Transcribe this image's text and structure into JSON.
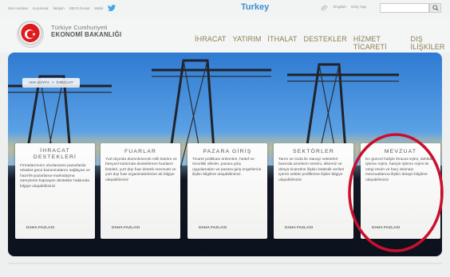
{
  "topbar": {
    "links": [
      "Site Haritası",
      "Kurumsal",
      "İletişim",
      "EBYS Evrak",
      "Mobil"
    ],
    "center_label": "Turkey",
    "lang_links": [
      "English",
      "Giriş Yap"
    ],
    "search_placeholder": ""
  },
  "header": {
    "org_line1": "Türkiye Cumhuriyeti",
    "org_line2": "EKONOMİ BAKANLIĞI",
    "nav": [
      "İHRACAT",
      "YATIRIM",
      "İTHALAT",
      "DESTEKLER",
      "HİZMET TİCARETİ",
      "DIŞ İLİŞKİLER"
    ]
  },
  "breadcrumb": {
    "home": "ANA SAYFA",
    "separator": ">",
    "current": "İHRACAT"
  },
  "cards": [
    {
      "title_lines": [
        "İHRACAT",
        "DESTEKLERİ"
      ],
      "body": "Firmalarımızın uluslararası pazarlarda rekabet gücü kazanmalarını sağlayan ve hazırlık-pazarlama-markalaşma süreçlerini kapsayan destekler hakkında bilgiye ulaşabilirsiniz",
      "more": "DAHA FAZLASI"
    },
    {
      "title_lines": [
        "FUARLAR"
      ],
      "body": "Yurt dışında düzenlenecek milli katılım ve bireysel katılımda desteklenen fuarların listeleri, yurt dışı fuar destek mevzuatı ve yurt dışı fuar organizatörlerine ait bilgiye ulaşabilirsiniz",
      "more": "DAHA FAZLASI"
    },
    {
      "title_lines": [
        "PAZARA GİRİŞ"
      ],
      "body": "Ticaret politikası önlemleri, hedef ve öncelikli ülkeler, pazara giriş uygulamaları ve pazara giriş engellerine ilişkin bilgilere ulaşabilirsiniz.",
      "more": "DAHA FAZLASI"
    },
    {
      "title_lines": [
        "SEKTÖRLER"
      ],
      "body": "Tarım ve Gıda ile Sanayi sektörleri bazında ürünlerin üretimi, ülkemiz ve dünya ticaretine ilişkin istatistik verileri içeren sektör profillerine ilişkin bilgiye ulaşabilirsiniz",
      "more": "DAHA FAZLASI"
    },
    {
      "title_lines": [
        "MEVZUAT"
      ],
      "body": "En güncel haliyle ihracat rejimi, dahilde işleme rejimi, hariçte işleme rejimi ile vergi resim ve harç istisnası mevzuatlarına ilişkin detaylı bilgilere ulaşabilirsiniz",
      "more": "DAHA FAZLASI"
    }
  ],
  "colors": {
    "accent_blue": "#3a8fd0",
    "nav_gold": "#8a7f52",
    "logo_red": "#e01a1a",
    "annotation_red": "#c8102e"
  }
}
